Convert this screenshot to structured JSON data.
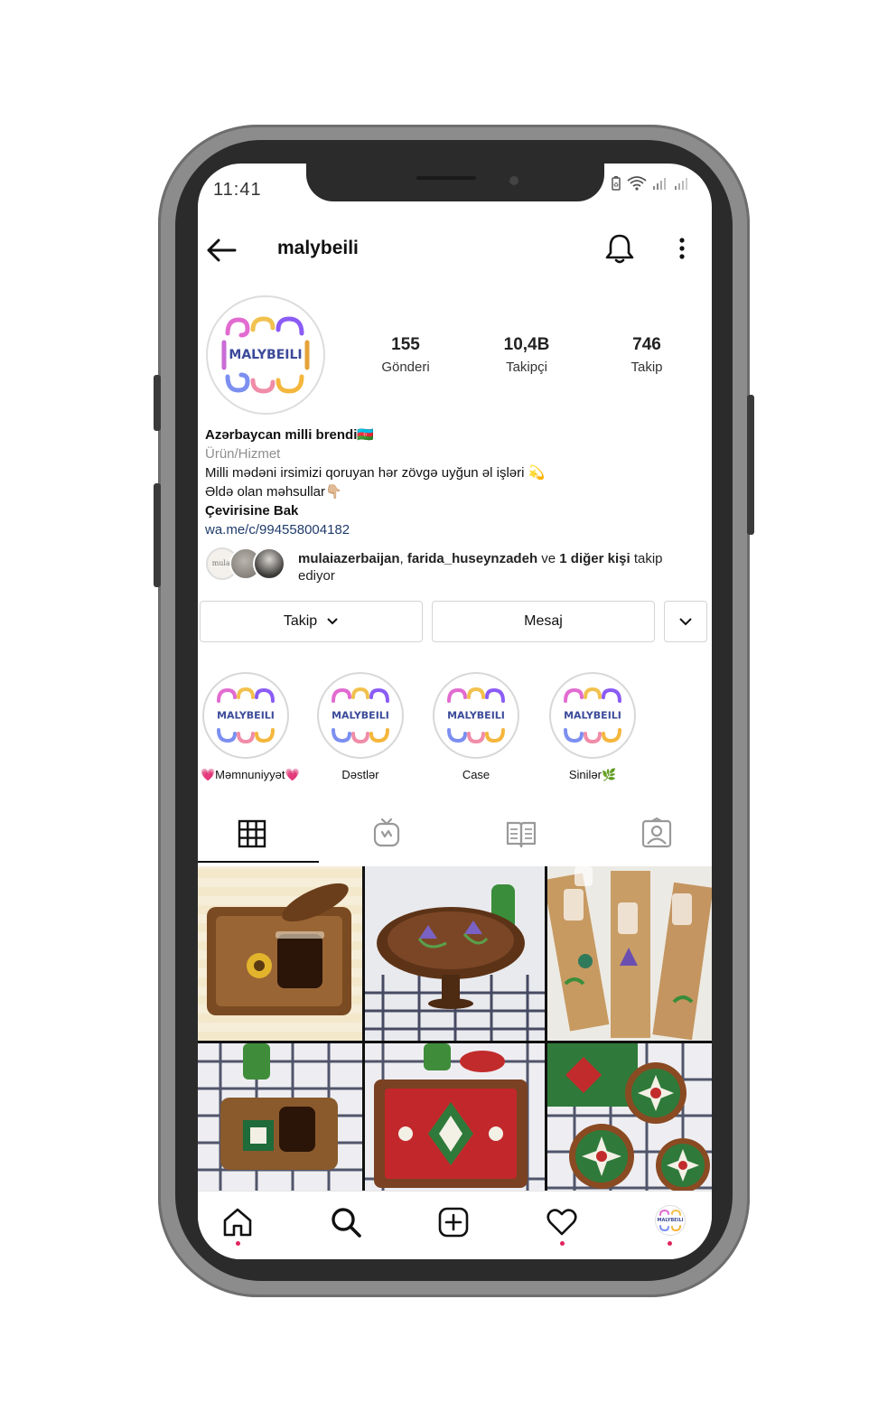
{
  "status_bar": {
    "time": "11:41"
  },
  "header": {
    "username": "malybeili",
    "back_icon": "arrow-left-icon",
    "bell_icon": "bell-icon",
    "more_icon": "more-vertical-icon"
  },
  "profile": {
    "avatar_text": "MALYBEILI",
    "stats": [
      {
        "value": "155",
        "label": "Gönderi"
      },
      {
        "value": "10,4B",
        "label": "Takipçi"
      },
      {
        "value": "746",
        "label": "Takip"
      }
    ]
  },
  "bio": {
    "name": "Azərbaycan milli brendi🇦🇿",
    "category": "Ürün/Hizmet",
    "line1": "Milli mədəni irsimizi qoruyan hər zövgə uyğun əl işləri 💫",
    "line2": "Əldə olan məhsullar👇🏼",
    "translate": "Çevirisine Bak",
    "link": "wa.me/c/994558004182"
  },
  "followed_by": {
    "user1": "mulaiazerbaijan",
    "sep": ", ",
    "user2": "farida_huseynzadeh",
    "connector": " ve ",
    "others": "1 diğer kişi",
    "suffix": " takip ediyor",
    "mini_avatar_text": "mulai"
  },
  "buttons": {
    "follow": "Takip",
    "message": "Mesaj"
  },
  "highlights": [
    {
      "label": "💗Məmnuniyyət💗",
      "text": "MALYBEILI"
    },
    {
      "label": "Dəstlər",
      "text": "MALYBEILI"
    },
    {
      "label": "Case",
      "text": "MALYBEILI"
    },
    {
      "label": "Sinilər🌿",
      "text": "MALYBEILI"
    }
  ],
  "tabs": [
    "grid-icon",
    "igtv-icon",
    "guide-icon",
    "tagged-icon"
  ],
  "bottom_nav": [
    "home-icon",
    "search-icon",
    "add-post-icon",
    "heart-icon",
    "profile-avatar"
  ],
  "colors": {
    "link": "#1f3b6b",
    "muted": "#8e8e8e",
    "notification_dot": "#e0245e",
    "logo_blue": "#3c4a9a"
  }
}
